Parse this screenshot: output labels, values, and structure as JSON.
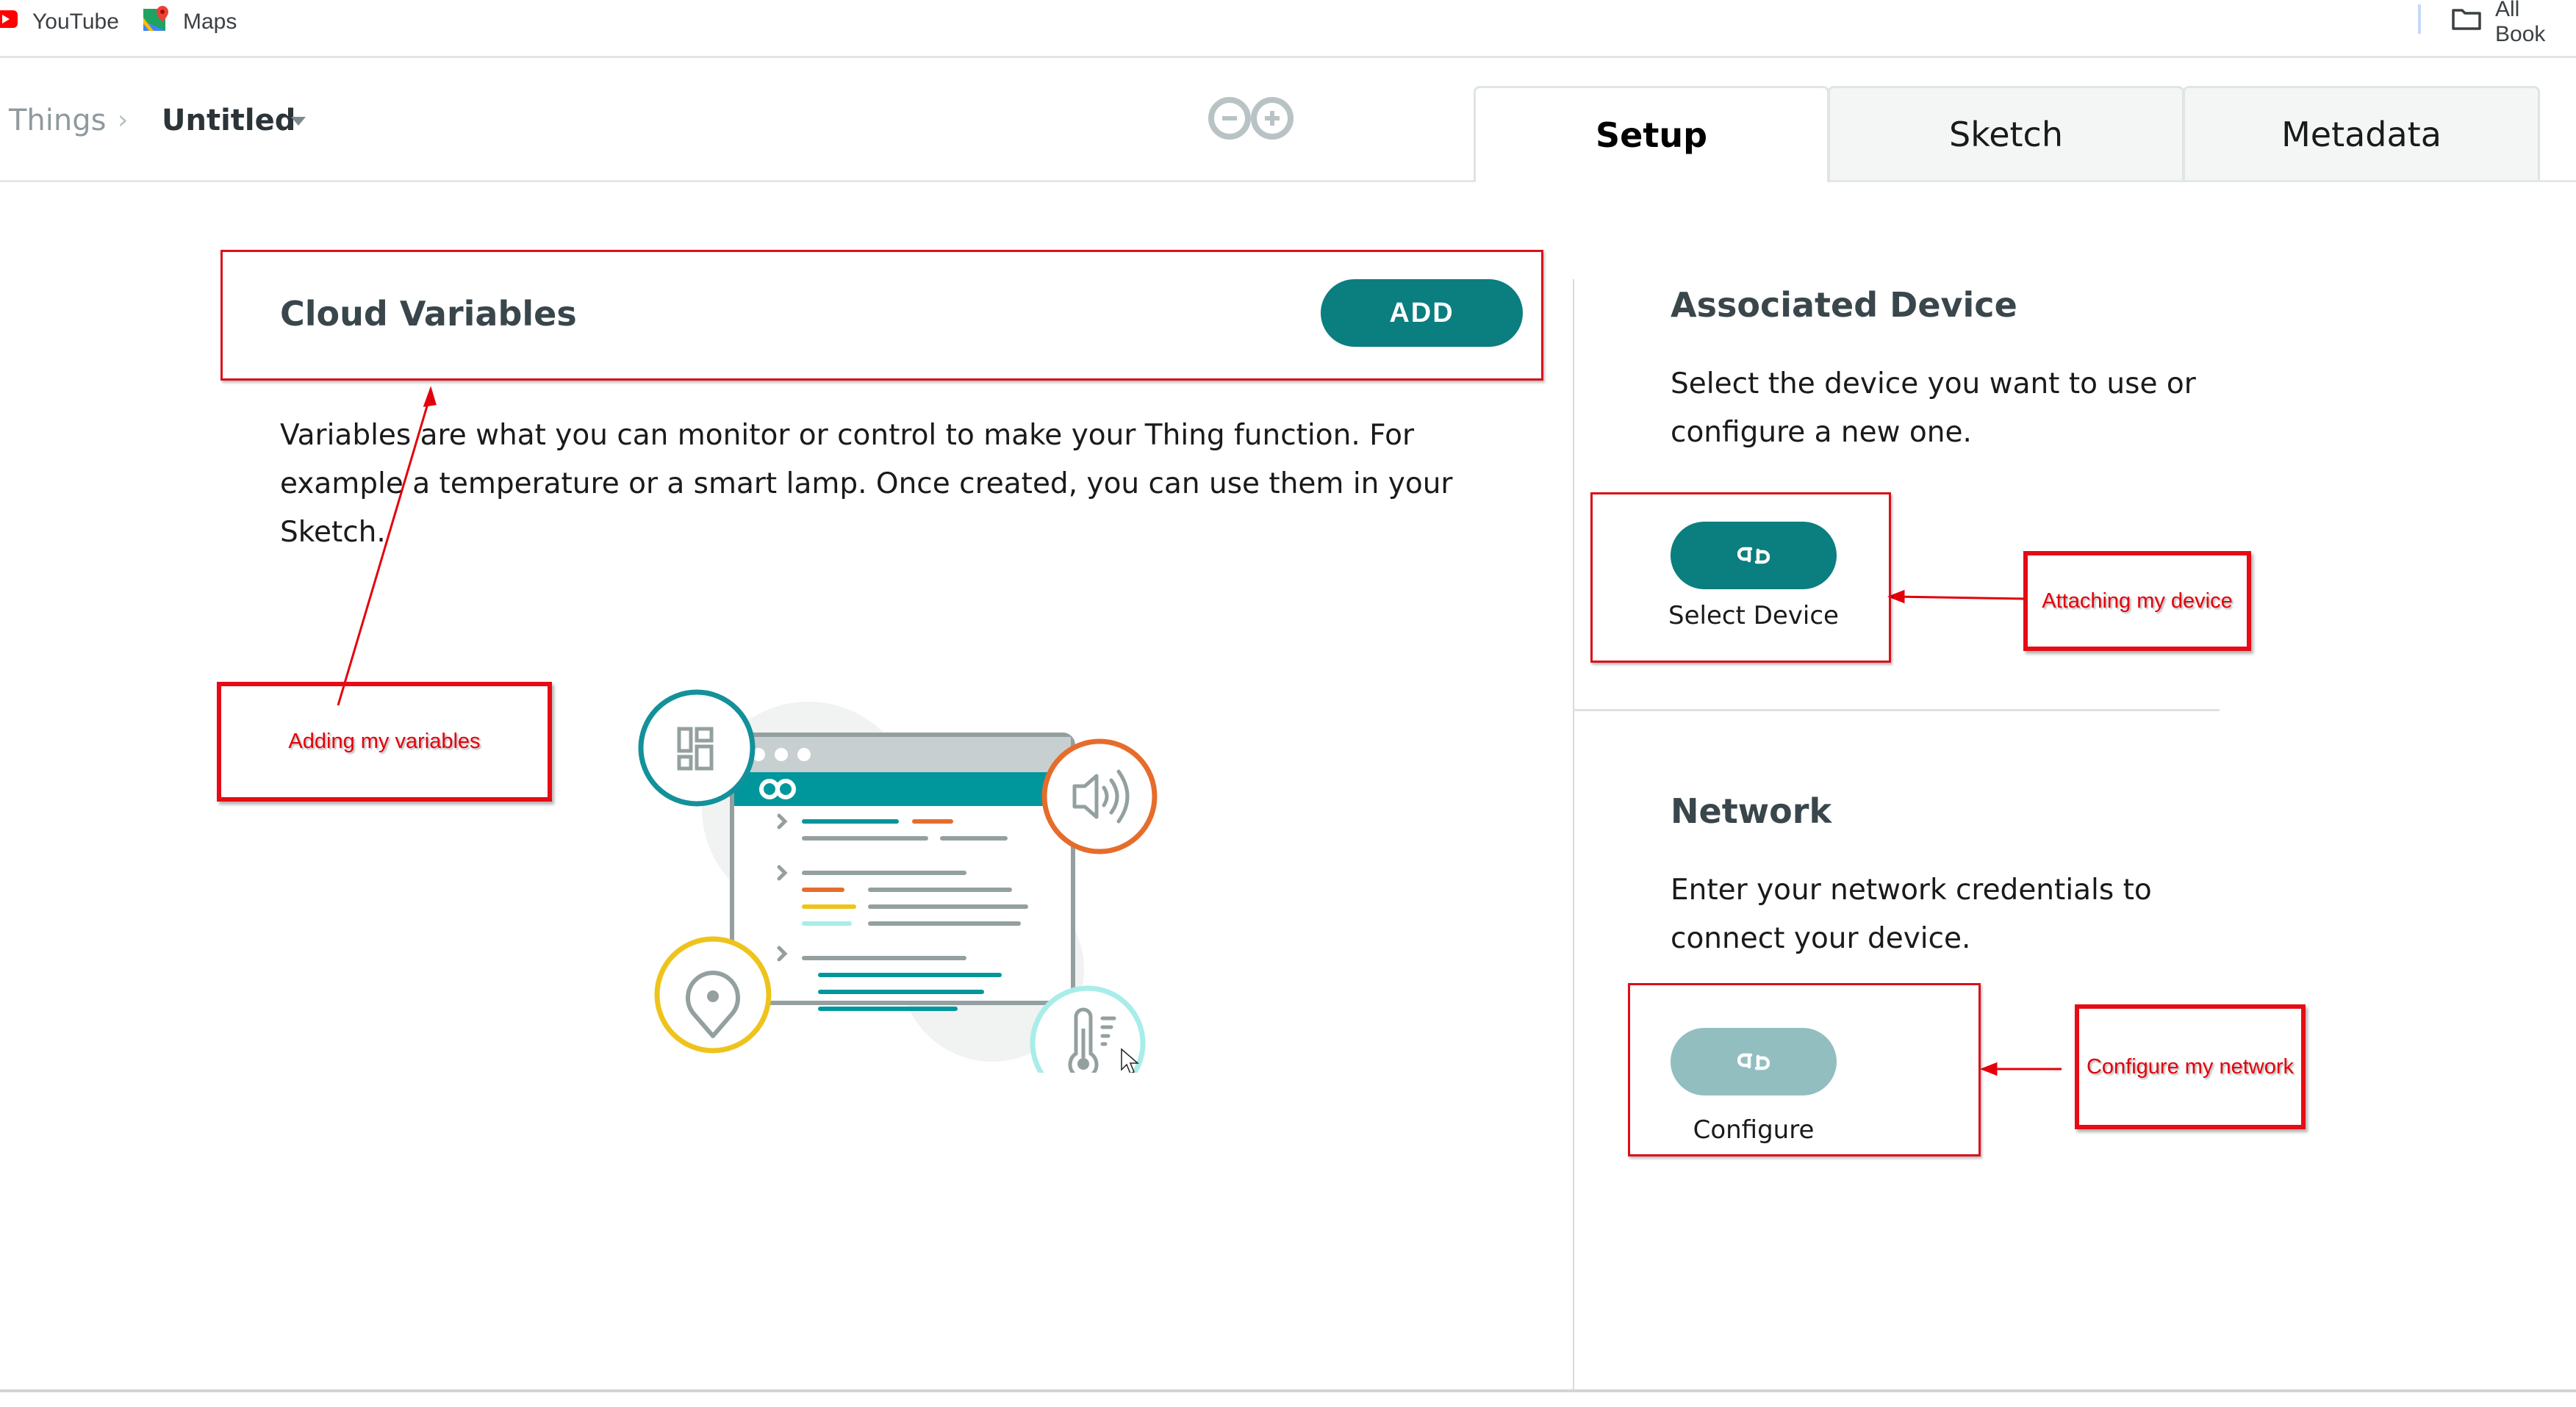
{
  "bookmarks": {
    "items": [
      {
        "label": "YouTube",
        "icon": "youtube-icon"
      },
      {
        "label": "Maps",
        "icon": "maps-icon"
      }
    ],
    "all_bookmarks": {
      "label": "All Book",
      "icon": "folder-icon"
    }
  },
  "header": {
    "breadcrumb": {
      "root": "Things",
      "separator": "›",
      "current": "Untitled"
    },
    "logo": "arduino-logo-icon",
    "tabs": [
      {
        "label": "Setup",
        "active": true
      },
      {
        "label": "Sketch",
        "active": false
      },
      {
        "label": "Metadata",
        "active": false
      }
    ]
  },
  "cloud_variables": {
    "title": "Cloud Variables",
    "add_label": "ADD",
    "description": "Variables are what you can monitor or control to make your Thing function. For example a temperature or a smart lamp. Once created, you can use them in your Sketch."
  },
  "associated_device": {
    "title": "Associated Device",
    "description": "Select the device you want to use or configure a new one.",
    "button_label": "Select Device",
    "button_icon": "link-icon"
  },
  "network": {
    "title": "Network",
    "description": "Enter your network credentials to connect your device.",
    "button_label": "Configure",
    "button_icon": "link-icon",
    "button_disabled": true
  },
  "annotations": {
    "variables": "Adding my variables",
    "device": "Attaching my device",
    "network": "Configure my network"
  },
  "colors": {
    "accent": "#0b7e7f",
    "accent_disabled": "#92bec0",
    "annotation_red": "#e3000b"
  }
}
